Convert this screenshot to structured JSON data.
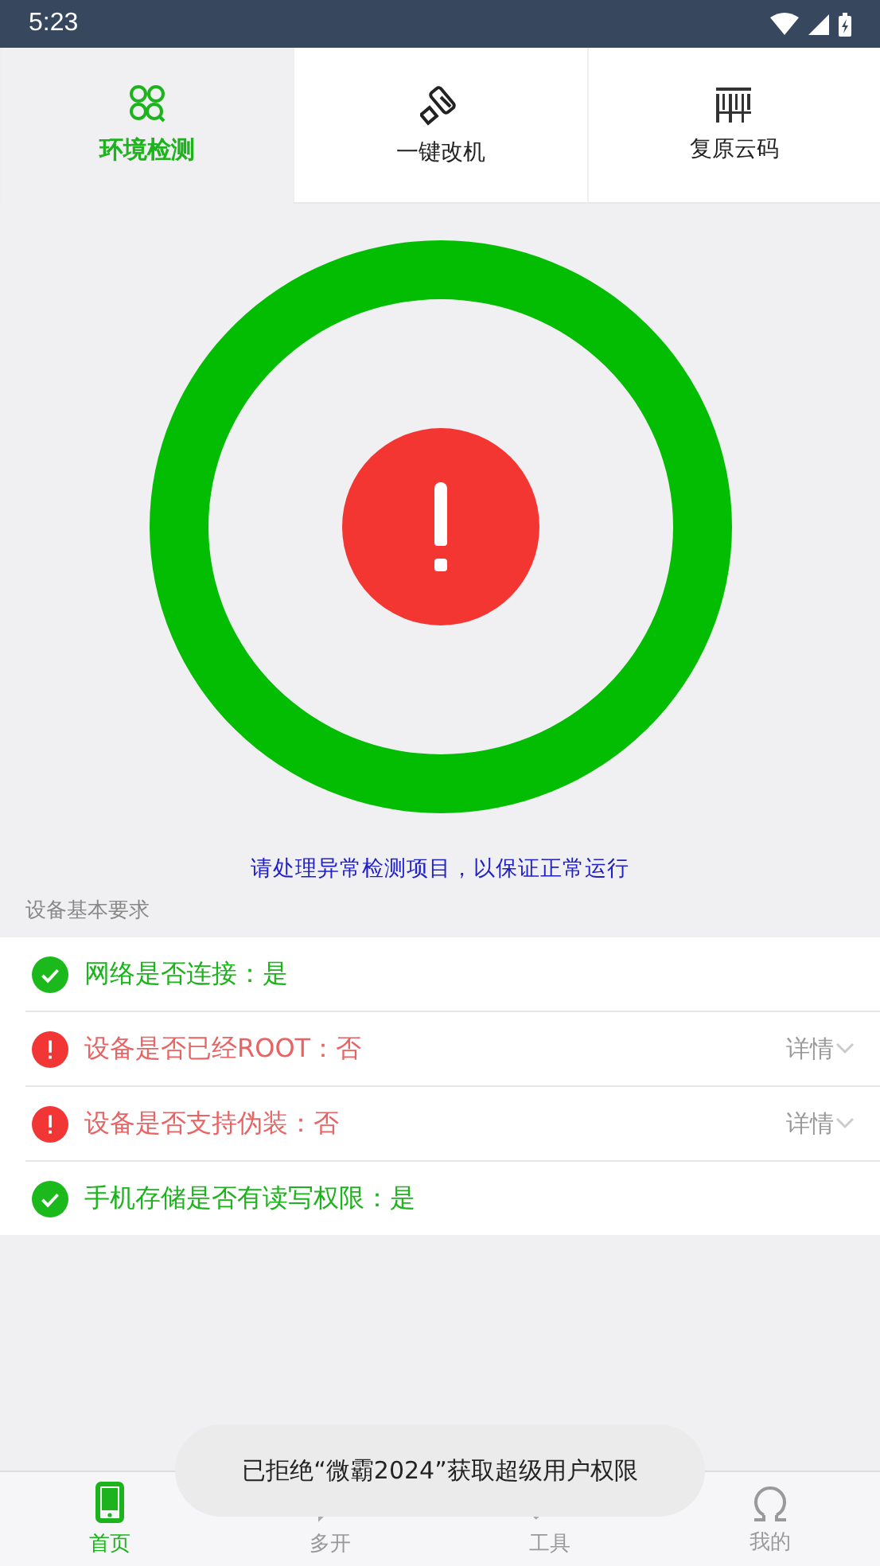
{
  "status_bar": {
    "time": "5:23"
  },
  "tabs": [
    {
      "label": "环境检测",
      "selected": true,
      "kind": "detect"
    },
    {
      "label": "一键改机",
      "selected": false,
      "kind": "roller"
    },
    {
      "label": "复原云码",
      "selected": false,
      "kind": "barcode"
    }
  ],
  "status_hint": "请处理异常检测项目，以保证正常运行",
  "section_title": "设备基本要求",
  "checks": [
    {
      "label": "网络是否连接：是",
      "kind": "ok"
    },
    {
      "label": "设备是否已经ROOT：否",
      "kind": "error",
      "detail": "详情"
    },
    {
      "label": "设备是否支持伪装：否",
      "kind": "error",
      "detail": "详情"
    },
    {
      "label": "手机存储是否有读写权限：是",
      "kind": "ok"
    }
  ],
  "toast": "已拒绝“微霸2024”获取超级用户权限",
  "bottom_nav": [
    {
      "label": "首页",
      "selected": true,
      "kind": "phone"
    },
    {
      "label": "多开",
      "selected": false,
      "kind": "chat"
    },
    {
      "label": "工具",
      "selected": false,
      "kind": "tools"
    },
    {
      "label": "我的",
      "selected": false,
      "kind": "user"
    }
  ]
}
